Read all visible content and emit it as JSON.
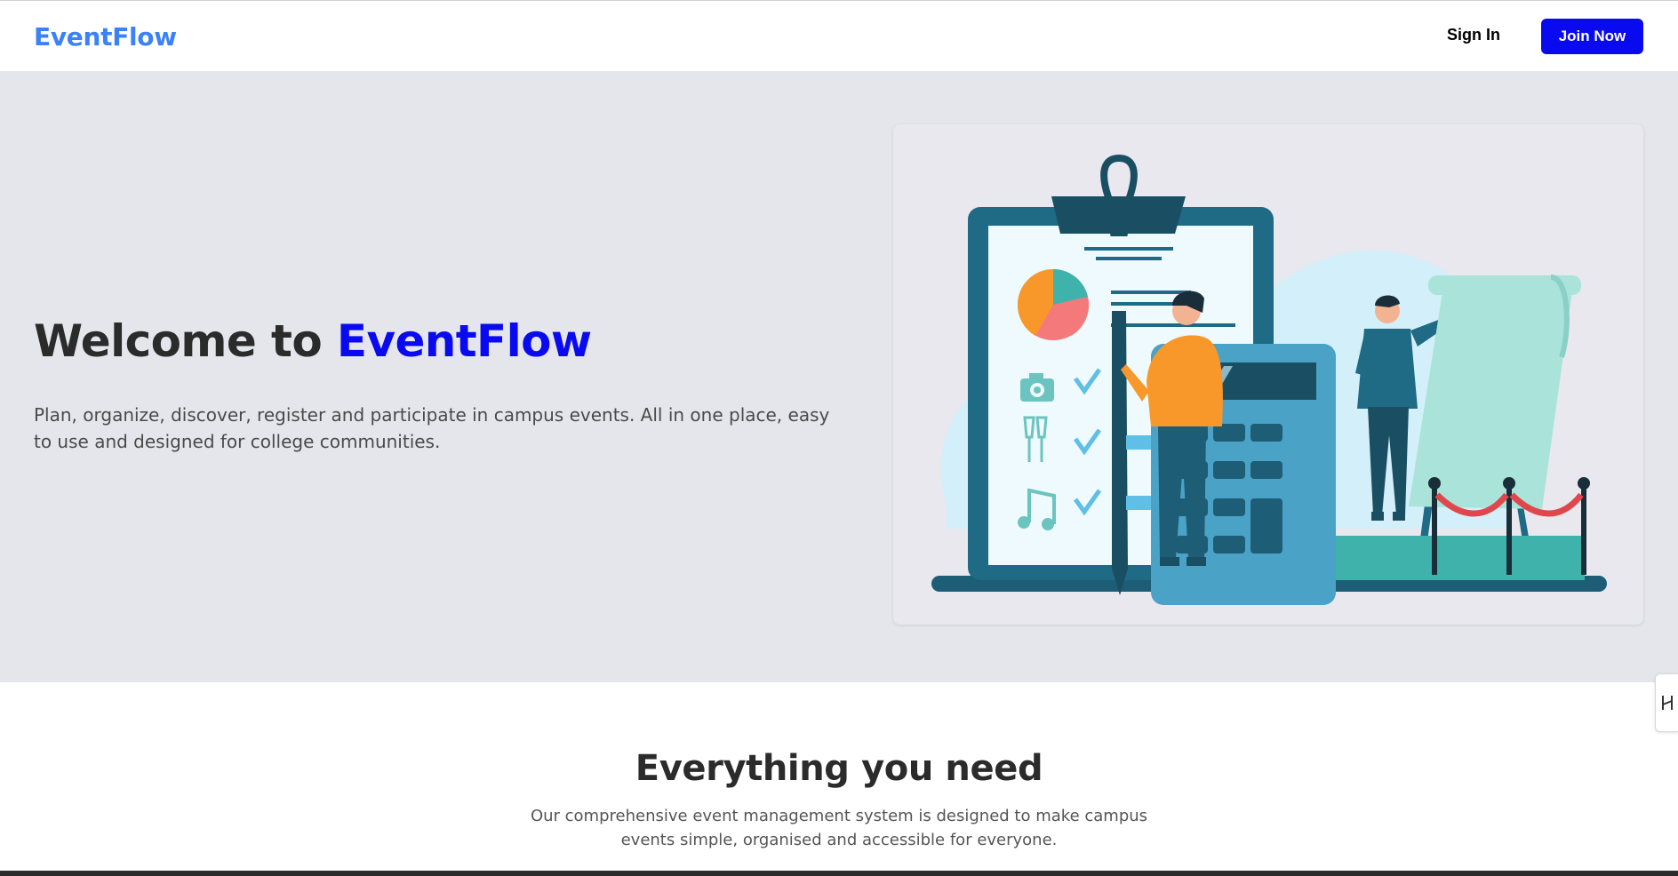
{
  "navbar": {
    "brand": "EventFlow",
    "signin_label": "Sign In",
    "join_label": "Join Now"
  },
  "hero": {
    "title_prefix": "Welcome to ",
    "title_accent": "EventFlow",
    "description": "Plan, organize, discover, register and participate in campus events. All in one place, easy to use and designed for college communities.",
    "illustration_icon": "event-planning-illustration"
  },
  "features": {
    "title": "Everything you need",
    "description": "Our comprehensive event management system is designed to make campus events simple, organised and accessible for everyone."
  },
  "side_widget": {
    "icon": "collapse-panel-icon"
  },
  "colors": {
    "brand": "#3b82f6",
    "accent": "#0a0af0",
    "hero_bg": "#e5e6ec",
    "text_dark": "#2b2b2b",
    "text_muted": "#4a4a4a"
  }
}
